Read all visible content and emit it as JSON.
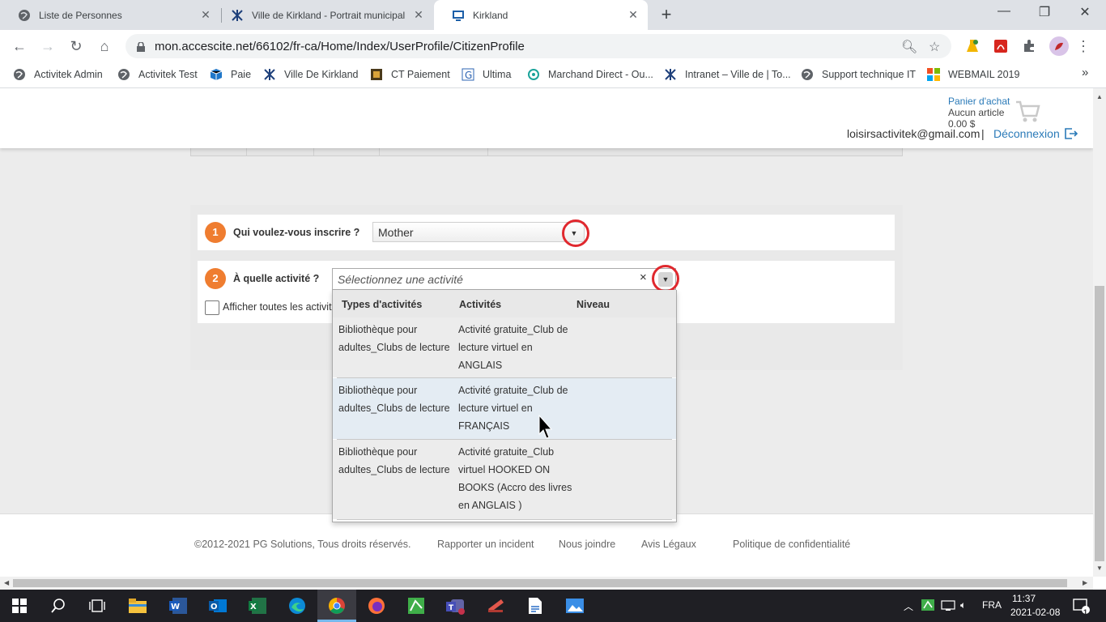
{
  "browser": {
    "tabs": [
      {
        "title": "Liste de Personnes"
      },
      {
        "title": "Ville de Kirkland - Portrait municipal"
      },
      {
        "title": "Kirkland"
      }
    ],
    "new_tab_symbol": "+",
    "url": "mon.accescite.net/66102/fr-ca/Home/Index/UserProfile/CitizenProfile",
    "bookmarks": [
      {
        "label": "Activitek Admin",
        "icon": "globe-icon"
      },
      {
        "label": "Activitek Test",
        "icon": "globe-icon"
      },
      {
        "label": "Paie",
        "icon": "box-icon"
      },
      {
        "label": "Ville De Kirkland",
        "icon": "kirkland-logo-icon"
      },
      {
        "label": "CT Paiement",
        "icon": "film-icon"
      },
      {
        "label": "Ultima",
        "icon": "ultima-icon"
      },
      {
        "label": "Marchand Direct - Ou...",
        "icon": "merchant-icon"
      },
      {
        "label": "Intranet – Ville de | To...",
        "icon": "kirkland-logo-icon"
      },
      {
        "label": "Support technique IT",
        "icon": "globe-icon"
      },
      {
        "label": "WEBMAIL 2019",
        "icon": "windows-logo-icon"
      }
    ],
    "bookmarks_more": "»"
  },
  "header": {
    "cart_title": "Panier d'achat",
    "cart_count": "Aucun article",
    "cart_total": "0.00 $",
    "email": "loisirsactivitek@gmail.com",
    "separator": "|",
    "logout": "Déconnexion"
  },
  "form": {
    "step1": {
      "number": "1",
      "label": "Qui voulez-vous inscrire ?",
      "selected": "Mother"
    },
    "step2": {
      "number": "2",
      "label": "À quelle activité ?",
      "placeholder": "Sélectionnez une activité",
      "clear_symbol": "×"
    },
    "show_all_label": "Afficher toutes les activités",
    "arrow_symbol": "▼"
  },
  "dropdown": {
    "headers": [
      "Types d'activités",
      "Activités",
      "Niveau"
    ],
    "rows": [
      {
        "type_l1": "Bibliothèque pour",
        "type_l2": "adultes_Clubs de lecture",
        "act_l1": "Activité gratuite_Club de",
        "act_l2": "lecture virtuel en",
        "act_l3": "ANGLAIS",
        "act_l4": "",
        "level": ""
      },
      {
        "type_l1": "Bibliothèque pour",
        "type_l2": "adultes_Clubs de lecture",
        "act_l1": "Activité gratuite_Club de",
        "act_l2": "lecture virtuel en",
        "act_l3": "FRANÇAIS",
        "act_l4": "",
        "level": ""
      },
      {
        "type_l1": "Bibliothèque pour",
        "type_l2": "adultes_Clubs de lecture",
        "act_l1": "Activité gratuite_Club",
        "act_l2": "virtuel HOOKED ON",
        "act_l3": "BOOKS (Accro des livres",
        "act_l4": "en ANGLAIS )",
        "level": ""
      }
    ]
  },
  "footer": {
    "copyright": "©2012-2021 PG Solutions, Tous droits réservés.",
    "report": "Rapporter un incident",
    "contact": "Nous joindre",
    "legal": "Avis Légaux",
    "privacy": "Politique de confidentialité"
  },
  "taskbar": {
    "language": "FRA",
    "time": "11:37",
    "date": "2021-02-08",
    "notification_count": "1"
  },
  "colors": {
    "accent_link": "#2a7ab8",
    "step_badge": "#ef7d30",
    "highlight_circle": "#e0282e"
  }
}
